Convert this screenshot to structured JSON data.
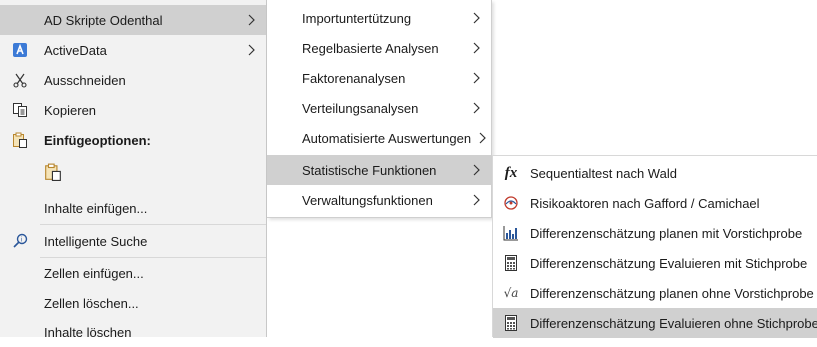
{
  "main_menu": {
    "items": [
      {
        "label": "AD Skripte Odenthal",
        "icon": "none",
        "has_submenu": true,
        "highlighted": true
      },
      {
        "label": "ActiveData",
        "icon": "activedata-icon",
        "has_submenu": true
      },
      {
        "label": "Ausschneiden",
        "icon": "scissors-icon"
      },
      {
        "label": "Kopieren",
        "icon": "copy-icon"
      },
      {
        "label": "Einfügeoptionen:",
        "icon": "paste-icon",
        "bold": true
      },
      {
        "label": "",
        "icon": "paste-icon"
      },
      {
        "label": "Inhalte einfügen...",
        "icon": "none"
      },
      {
        "label": "Intelligente Suche",
        "icon": "search-icon"
      },
      {
        "label": "Zellen einfügen...",
        "icon": "none"
      },
      {
        "label": "Zellen löschen...",
        "icon": "none"
      },
      {
        "label": "Inhalte löschen",
        "icon": "none"
      }
    ]
  },
  "ad_submenu": {
    "items": [
      {
        "label": "Importuntertützung"
      },
      {
        "label": "Regelbasierte Analysen"
      },
      {
        "label": "Faktorenanalysen"
      },
      {
        "label": "Verteilungsanalysen"
      },
      {
        "label": "Automatisierte Auswertungen"
      },
      {
        "label": "Statistische Funktionen",
        "highlighted": true
      },
      {
        "label": "Verwaltungsfunktionen"
      }
    ]
  },
  "stat_submenu": {
    "items": [
      {
        "label": "Sequentialtest nach Wald",
        "icon": "fx-icon"
      },
      {
        "label": "Risikoaktoren nach Gafford / Camichael",
        "icon": "risk-icon"
      },
      {
        "label": "Differenzenschätzung planen mit Vorstichprobe",
        "icon": "chart-icon"
      },
      {
        "label": "Differenzenschätzung Evaluieren mit Stichprobe",
        "icon": "calculator-icon"
      },
      {
        "label": "Differenzenschätzung planen ohne Vorstichprobe",
        "icon": "sqrt-icon"
      },
      {
        "label": "Differenzenschätzung Evaluieren ohne Stichprobe",
        "icon": "calculator-icon",
        "highlighted": true
      }
    ]
  },
  "colors": {
    "menu_bg": "#f2f2f2",
    "highlight": "#d0d0d0",
    "accent": "#2b579a"
  }
}
